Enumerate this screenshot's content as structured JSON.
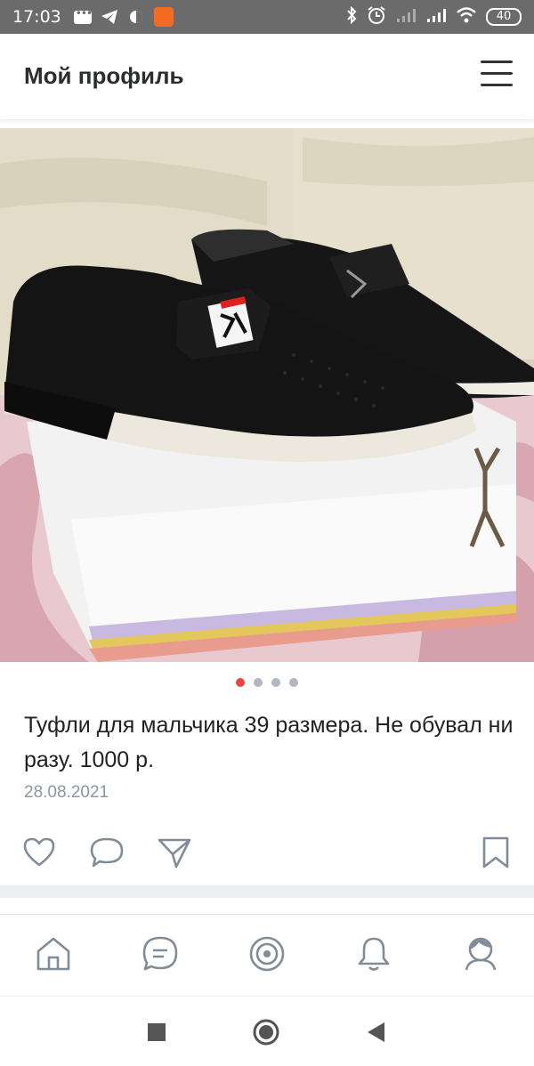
{
  "status_bar": {
    "time": "17:03",
    "battery": "40",
    "left_icons": [
      "message-icon",
      "telegram-icon",
      "vpn-icon",
      "app-icon"
    ],
    "right_icons": [
      "bluetooth-icon",
      "alarm-icon",
      "signal-icon",
      "signal-icon",
      "wifi-icon",
      "battery-icon"
    ]
  },
  "header": {
    "title": "Мой профиль",
    "menu_icon": "hamburger-menu-icon"
  },
  "post": {
    "photo_subject": "black shoes on white box",
    "carousel": {
      "total": 4,
      "active_index": 0
    },
    "text": "Туфли для мальчика 39 размера. Не обувал ни разу. 1000 р.",
    "date": "28.08.2021",
    "actions": [
      "like-icon",
      "comment-icon",
      "share-icon",
      "bookmark-icon"
    ]
  },
  "tab_bar": {
    "tabs": [
      "home-icon",
      "messages-icon",
      "discover-icon",
      "notifications-icon",
      "profile-icon"
    ]
  },
  "nav_bar": {
    "buttons": [
      "recents-button",
      "home-button",
      "back-button"
    ]
  },
  "colors": {
    "accent": "#e64646",
    "icon": "#818c99",
    "status_bar_bg": "#6b6b6b"
  }
}
